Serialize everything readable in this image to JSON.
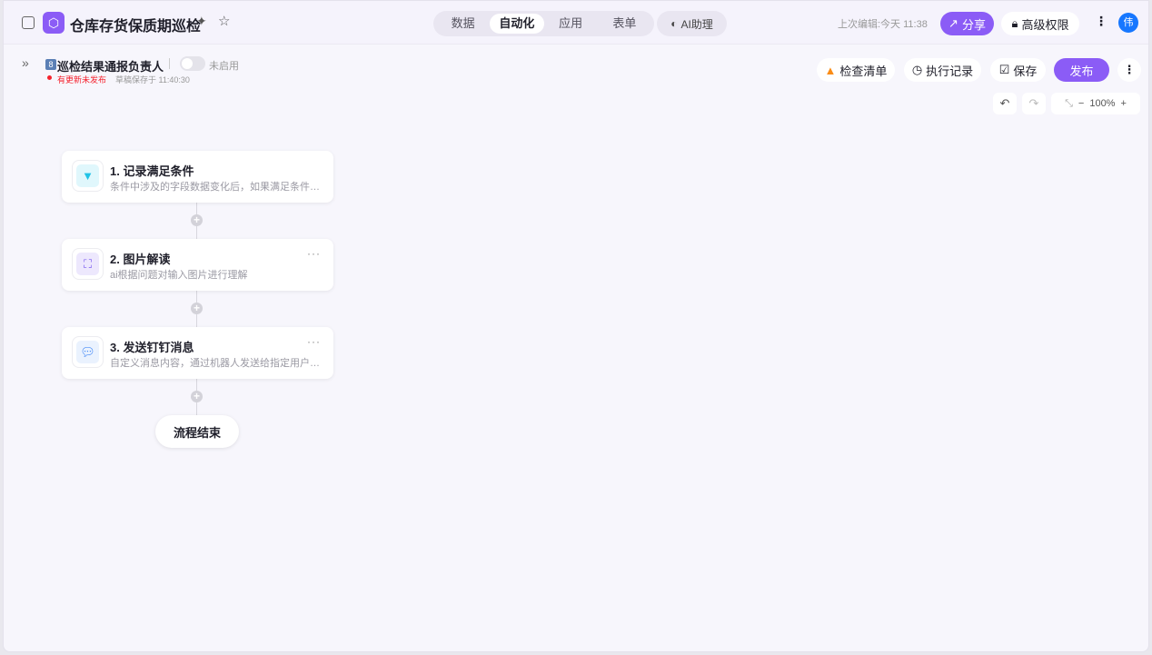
{
  "header": {
    "title": "仓库存货保质期巡检",
    "tabs": [
      {
        "label": "数据"
      },
      {
        "label": "自动化"
      },
      {
        "label": "应用"
      },
      {
        "label": "表单"
      }
    ],
    "ai_label": "AI助理",
    "last_edit": "上次编辑:今天 11:38",
    "share_label": "分享",
    "permission_label": "高级权限",
    "avatar": "伟"
  },
  "sub": {
    "emoji": "8",
    "flow_name": "巡检结果通报负责人",
    "toggle_label": "未启用",
    "unpublished": "有更新未发布",
    "draft": "草稿保存于 11:40:30",
    "check_label": "检查清单",
    "history_label": "执行记录",
    "save_label": "保存",
    "publish_label": "发布",
    "zoom": "100%"
  },
  "nodes": [
    {
      "title": "1. 记录满足条件",
      "desc": "条件中涉及的字段数据变化后，如果满足条件则执行"
    },
    {
      "title": "2. 图片解读",
      "desc": "ai根据问题对输入图片进行理解"
    },
    {
      "title": "3. 发送钉钉消息",
      "desc": "自定义消息内容，通过机器人发送给指定用户或群"
    }
  ],
  "end_label": "流程结束",
  "colors": {
    "accent": "#8b5cf6",
    "avatar": "#1677ff"
  }
}
